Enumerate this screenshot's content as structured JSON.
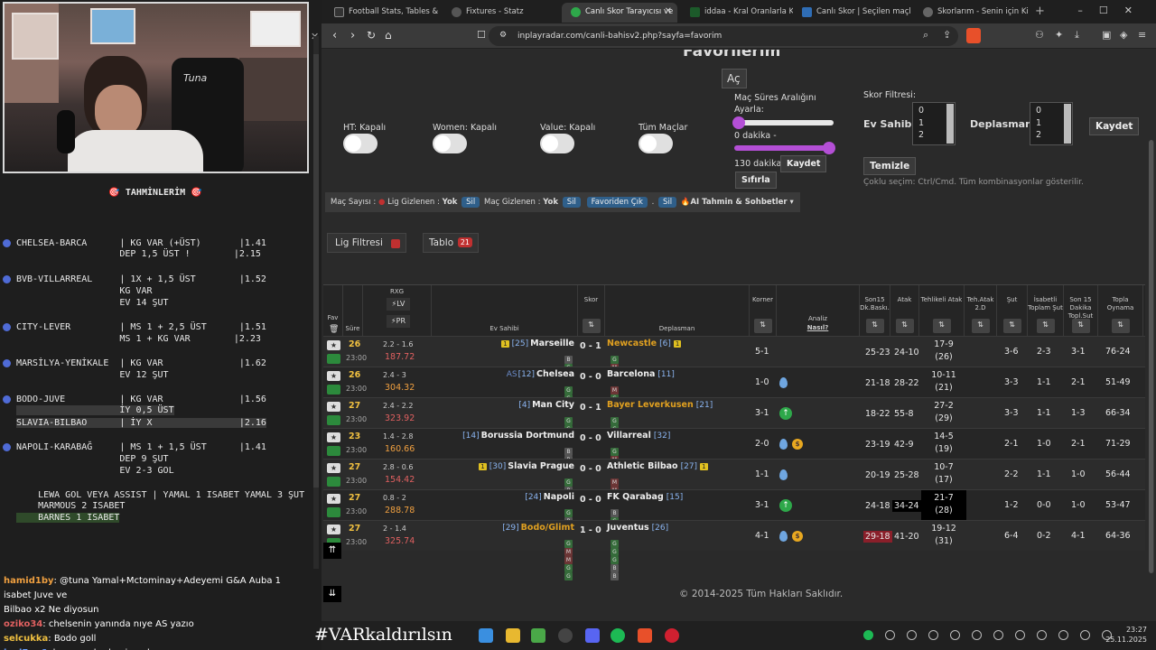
{
  "stream": {
    "predictions_title": "🎯 TAHMİNLERİM 🎯",
    "lines": [
      {
        "text": "CHELSEA-BARCA      | KG VAR (+ÜST)       |1.41",
        "dot": true
      },
      {
        "text": "                   DEP 1,5 ÜST !        |2.15",
        "dot": false
      },
      {
        "text": "BVB-VILLARREAL     | 1X + 1,5 ÜST        |1.52",
        "dot": true
      },
      {
        "text": "                   KG VAR",
        "dot": false
      },
      {
        "text": "                   EV 14 ŞUT",
        "dot": false
      },
      {
        "text": "CITY-LEVER         | MS 1 + 2,5 ÜST      |1.51",
        "dot": true
      },
      {
        "text": "                   MS 1 + KG VAR        |2.23",
        "dot": false
      },
      {
        "text": "MARSİLYA-YENİKALE  | KG VAR              |1.62",
        "dot": true
      },
      {
        "text": "                   EV 12 ŞUT",
        "dot": false
      },
      {
        "text": "BODO-JUVE          | KG VAR              |1.56",
        "dot": true
      },
      {
        "text": "                   İY 0,5 ÜST",
        "dot": false,
        "hl": true
      },
      {
        "text": "SLAVIA-BILBAO      | İY X                |2.16",
        "dot": false,
        "hl": true
      },
      {
        "text": "NAPOLI-KARABAĞ     | MS 1 + 1,5 ÜST      |1.41",
        "dot": true
      },
      {
        "text": "                   DEP 9 ŞUT",
        "dot": false
      },
      {
        "text": "                   EV 2-3 GOL",
        "dot": false
      },
      {
        "text": "    LEWA GOL VEYA ASSIST | YAMAL 1 ISABET YAMAL 3 ŞUT",
        "dot": false
      },
      {
        "text": "    MARMOUS 2 ISABET",
        "dot": false
      },
      {
        "text": "    BARNES 1 ISABET",
        "dot": false,
        "hl2": true
      }
    ],
    "chat": [
      {
        "user": "hamid1by",
        "msg": ": @tuna Yamal+Mctominay+Adeyemi G&A Auba 1 isabet Juve ve"
      },
      {
        "user": "",
        "msg": "Bilbao x2 Ne diyosun"
      },
      {
        "user": "oziko34",
        "msg": ": chelsenin yanında nıye AS yazıo"
      },
      {
        "user": "selcukka",
        "msg": ": Bodo goll"
      },
      {
        "user": "jealEge6",
        "msg": ": başımız derde girecek"
      }
    ],
    "cam_logo": "Tuna"
  },
  "browser": {
    "tabs": [
      "Football Stats, Tables & Da",
      "Fixtures - Statz",
      "Canlı Skor Tarayıcısı ve",
      "iddaa - Kral Oranlarla Kralı",
      "Canlı Skor | Seçilen maçlar",
      "Skorlarım - Senin için Kişis"
    ],
    "url": "inplayradar.com/canli-bahisv2.php?sayfa=favorim"
  },
  "page": {
    "title": "Favorilerim",
    "ac_label": "Aç",
    "toggles": [
      "HT: Kapalı",
      "Women: Kapalı",
      "Value: Kapalı",
      "Tüm Maçlar"
    ],
    "range_label": "Maç Süres Aralığını Ayarla:",
    "range_low": "0 dakika -",
    "range_high": "130 dakika",
    "save_label": "Kaydet",
    "reset_label": "Sıfırla",
    "score_filter_label": "Skor Filtresi:",
    "home_label": "Ev Sahibi:",
    "away_label": "Deplasman:",
    "options": [
      "0",
      "1",
      "2"
    ],
    "save2_label": "Kaydet",
    "clear_label": "Temizle",
    "hint": "Çoklu seçim: Ctrl/Cmd. Tüm kombinasyonlar gösterilir.",
    "toolbar": {
      "match_count": "Maç Sayısı :",
      "league_hidden": "Lig Gizlenen :",
      "yok1": "Yok",
      "sil1": "Sil",
      "match_hidden": "Maç Gizlenen :",
      "yok2": "Yok",
      "sil2": "Sil",
      "fav_out": "Favoriden Çık",
      "dot": ".",
      "sil3": "Sil",
      "ai": "🔥AI Tahmin & Sohbetler ▾"
    },
    "league_filter": "Lig Filtresi",
    "tablo": "Tablo",
    "tablo_count": "21",
    "copyright": "© 2014-2025 Tüm Hakları Saklıdır."
  },
  "table": {
    "headers": {
      "fav": "Fav",
      "sure": "Süre",
      "rxg": "RXG",
      "lv": "⚡LV",
      "pr": "⚡PR",
      "home": "Ev Sahibi",
      "skor": "Skor",
      "away": "Deplasman",
      "korner": "Korner",
      "analiz": "Analiz",
      "nasil": "Nasıl?",
      "son15": "Son15 Dk.Baskı.",
      "atak": "Atak",
      "tehlikeli": "Tehlikeli Atak",
      "teh2d": "Teh.Atak 2.D",
      "sut": "Şut",
      "isabetli": "İsabetli Toplam Şut",
      "son15sut": "Son 15 Dakika Topl.Sut",
      "topla": "Topla Oynama"
    },
    "rows": [
      {
        "min": "26",
        "time": "23:00",
        "xg": "2.2 - 1.6",
        "pr": "187.72",
        "home": "Marseille",
        "hrank": "[25]",
        "hcard": "1",
        "score": "0 - 1",
        "away": "Newcastle",
        "arank": "[6]",
        "acard": "1",
        "away_or": true,
        "hform": "BGMGG",
        "aform": "GMGMG",
        "korner": "5-1",
        "analiz": [],
        "son15": "25-23",
        "atak": "24-10",
        "teh": "17-9",
        "teh2": "(26)",
        "sut": "3-6",
        "isabet": "2-3",
        "son15sut": "3-1",
        "topla": "76-24"
      },
      {
        "min": "26",
        "time": "23:00",
        "xg": "2.4 - 3",
        "pr": "304.32",
        "home": "Chelsea",
        "hrank": "[12]",
        "hpre": "AS",
        "score": "0 - 0",
        "away": "Barcelona",
        "arank": "[11]",
        "hform": "GGBGG",
        "aform": "MGBGG",
        "korner": "1-0",
        "analiz": [
          "drop"
        ],
        "son15": "21-18",
        "atak": "28-22",
        "teh": "10-11",
        "teh2": "(21)",
        "sut": "3-3",
        "isabet": "1-1",
        "son15sut": "2-1",
        "topla": "51-49"
      },
      {
        "min": "27",
        "time": "23:00",
        "xg": "2.4 - 2.2",
        "pr": "323.92",
        "home": "Man City",
        "hrank": "[4]",
        "score": "0 - 1",
        "away": "Bayer Leverkusen",
        "arank": "[21]",
        "away_or": true,
        "hform": "GGGMG",
        "aform": "GGGGG",
        "korner": "3-1",
        "analiz": [
          "up"
        ],
        "son15": "18-22",
        "atak": "55-8",
        "teh": "27-2",
        "teh2": "(29)",
        "sut": "3-3",
        "isabet": "1-1",
        "son15sut": "1-3",
        "topla": "66-34"
      },
      {
        "min": "23",
        "time": "23:00",
        "xg": "1.4 - 2.8",
        "pr": "160.66",
        "home": "Borussia Dortmund",
        "hrank": "[14]",
        "score": "0 - 0",
        "away": "Villarreal",
        "arank": "[32]",
        "hform": "BBMGG",
        "aform": "GMGGG",
        "korner": "2-0",
        "analiz": [
          "drop",
          "bag"
        ],
        "son15": "23-19",
        "atak": "42-9",
        "teh": "14-5",
        "teh2": "(19)",
        "sut": "2-1",
        "isabet": "1-0",
        "son15sut": "2-1",
        "topla": "71-29"
      },
      {
        "min": "27",
        "time": "23:00",
        "xg": "2.8 - 0.6",
        "pr": "154.42",
        "home": "Slavia Prague",
        "hrank": "[30]",
        "hcard": "1",
        "score": "0 - 0",
        "away": "Athletic Bilbao",
        "arank": "[27]",
        "acard": "1",
        "hform": "GBGGG",
        "aform": "MMGMM",
        "korner": "1-1",
        "analiz": [
          "drop"
        ],
        "son15": "20-19",
        "atak": "25-28",
        "teh": "10-7",
        "teh2": "(17)",
        "sut": "2-2",
        "isabet": "1-1",
        "son15sut": "1-0",
        "topla": "56-44"
      },
      {
        "min": "27",
        "time": "23:00",
        "xg": "0.8 - 2",
        "pr": "288.78",
        "home": "Napoli",
        "hrank": "[24]",
        "score": "0 - 0",
        "away": "FK Qarabag",
        "arank": "[15]",
        "hform": "GBMGG",
        "aform": "BGBGG",
        "korner": "3-1",
        "analiz": [
          "up"
        ],
        "son15": "24-18",
        "atak": "34-24",
        "atak_blk": true,
        "teh": "21-7",
        "teh2": "(28)",
        "teh_blk": true,
        "sut": "1-2",
        "isabet": "0-0",
        "son15sut": "1-0",
        "topla": "53-47"
      },
      {
        "min": "27",
        "time": "23:00",
        "xg": "2 - 1.4",
        "pr": "325.74",
        "home": "Bodo/Glimt",
        "hrank": "[29]",
        "home_or": true,
        "score": "1 - 0",
        "away": "Juventus",
        "arank": "[26]",
        "hform": "GMMGG",
        "aform": "GGGBB",
        "korner": "4-1",
        "analiz": [
          "drop",
          "bag"
        ],
        "son15": "29-18",
        "son15_red": true,
        "atak": "41-20",
        "teh": "19-12",
        "teh2": "(31)",
        "sut": "6-4",
        "isabet": "0-2",
        "son15sut": "4-1",
        "topla": "64-36"
      }
    ]
  },
  "taskbar": {
    "hashtag": "#VARkaldırılsın",
    "time": "23:27",
    "date": "25.11.2025"
  }
}
